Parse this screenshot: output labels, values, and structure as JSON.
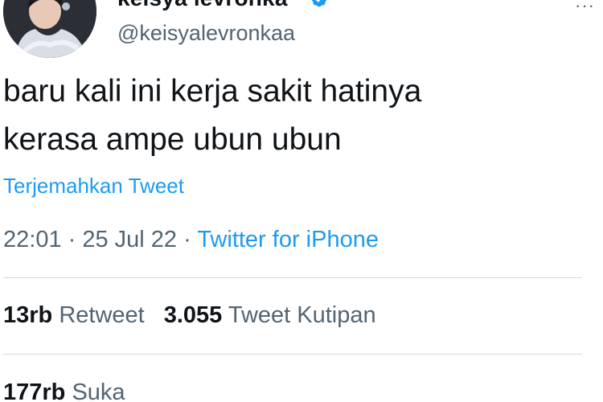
{
  "user": {
    "display_name": "keisya levronka",
    "handle": "@keisyalevronkaa",
    "verified": true
  },
  "tweet": {
    "text_lines": [
      "baru kali ini kerja sakit hatinya",
      "kerasa ampe ubun ubun"
    ],
    "translate_label": "Terjemahkan Tweet",
    "time": "22:01",
    "separator": " · ",
    "date": "25 Jul 22",
    "source": "Twitter for iPhone"
  },
  "stats": {
    "retweets": {
      "count": "13rb",
      "label": "Retweet"
    },
    "quotes": {
      "count": "3.055",
      "label": "Tweet Kutipan"
    },
    "likes": {
      "count": "177rb",
      "label": "Suka"
    }
  },
  "icons": {
    "verified": "verified-badge-icon",
    "more": "more-options-icon"
  },
  "colors": {
    "link": "#1d9bf0",
    "secondary_text": "#536471",
    "primary_text": "#0f1419",
    "divider": "#cfd9de"
  }
}
